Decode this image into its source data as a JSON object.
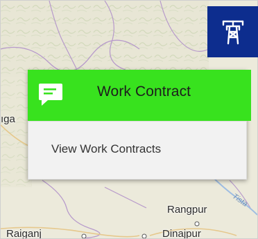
{
  "map": {
    "places": {
      "left_partial": "ıga",
      "rangpur": "Rangpur",
      "raiganj": "Raiganj",
      "dinajpur": "Dinajpur"
    },
    "river": "Tista"
  },
  "tool": {
    "icon": "tower-icon"
  },
  "menu": {
    "icon": "chat-icon",
    "title": "Work Contract",
    "items": [
      {
        "label": "View Work Contracts"
      }
    ]
  },
  "colors": {
    "header_green": "#38e21e",
    "tool_blue": "#0d2d8e",
    "menu_bg": "#f2f2f2"
  }
}
